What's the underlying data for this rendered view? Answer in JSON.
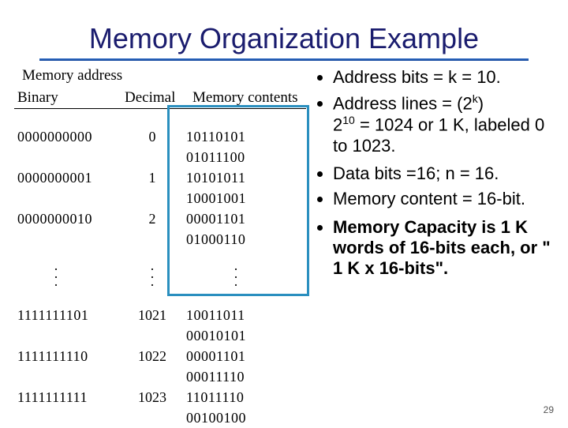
{
  "title": "Memory Organization Example",
  "figure": {
    "headers": {
      "addr": "Memory address",
      "bin": "Binary",
      "dec": "Decimal",
      "cont": "Memory contents"
    },
    "top_rows": [
      {
        "bin": "0000000000",
        "dec": "0",
        "cont": "10110101 01011100"
      },
      {
        "bin": "0000000001",
        "dec": "1",
        "cont": "10101011 10001001"
      },
      {
        "bin": "0000000010",
        "dec": "2",
        "cont": "00001101 01000110"
      }
    ],
    "bottom_rows": [
      {
        "bin": "1111111101",
        "dec": "1021",
        "cont": "10011011 00010101"
      },
      {
        "bin": "1111111110",
        "dec": "1022",
        "cont": "00001101 00011110"
      },
      {
        "bin": "1111111111",
        "dec": "1023",
        "cont": "11011110 00100100"
      }
    ]
  },
  "bullets": {
    "b1": "Address bits = k = 10.",
    "b2_a": "Address lines = (2",
    "b2_b": ")",
    "b2_exp": "k",
    "b2_line2a": "2",
    "b2_line2exp": "10",
    "b2_line2b": " = 1024 or 1 K, labeled 0 to 1023.",
    "b3": "Data bits =16;  n = 16.",
    "b4": "Memory content = 16-bit.",
    "b5_a": "Memory Capacity is 1 K words of 16-bits each, or ",
    "b5_q": "\" 1 K x 16-bits\"."
  },
  "page_number": "29"
}
